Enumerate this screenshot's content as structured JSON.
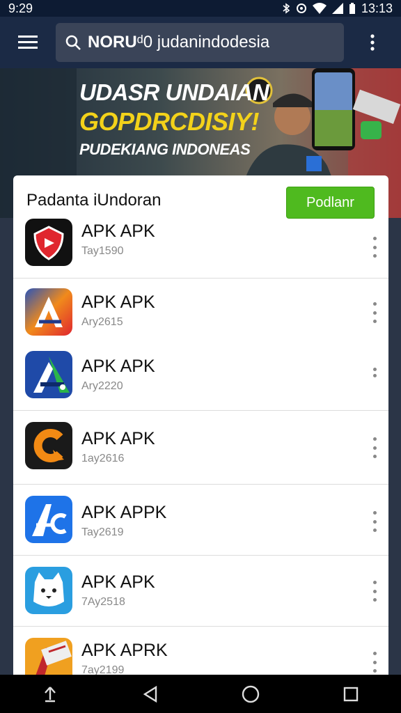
{
  "status_bar": {
    "time": "9:29",
    "right_time": "13:13"
  },
  "search": {
    "query_bold": "NORU",
    "query_rest": "ᵈ0 judanindodesia"
  },
  "banner": {
    "line1": "UDASR UNDAIAN",
    "line2": "GOPDRCDISIY!",
    "line3": "PUDEKIANG INDONEAS"
  },
  "panel": {
    "title": "Padanta iUndoran",
    "button_label": "Podlanr"
  },
  "apps": [
    {
      "name": "APK APK",
      "sub": "Tay1590",
      "icon": "shield-play-icon",
      "bg": "#111111",
      "fg": "#e0262e"
    },
    {
      "name": "APK APK",
      "sub": "Ary2615",
      "icon": "letter-a-gradient-icon",
      "bg": "#f08a1c",
      "fg": "#1f3a8a"
    },
    {
      "name": "APK APK",
      "sub": "Ary2220",
      "icon": "letter-a-blue-icon",
      "bg": "#1f4aa8",
      "fg": "#2bb44a"
    },
    {
      "name": "APK APK",
      "sub": "1ay2616",
      "icon": "letter-c-orange-icon",
      "bg": "#1a1a1a",
      "fg": "#f28a14"
    },
    {
      "name": "APK APPK",
      "sub": "Tay2619",
      "icon": "letter-ac-blue-icon",
      "bg": "#1e73e8",
      "fg": "#ffffff"
    },
    {
      "name": "APK APK",
      "sub": "7Ay2518",
      "icon": "cat-face-icon",
      "bg": "#2a9ee0",
      "fg": "#ffffff"
    },
    {
      "name": "APK APRK",
      "sub": "7ay2199",
      "icon": "letter-a-stamp-icon",
      "bg": "#f0a020",
      "fg": "#c0282c"
    }
  ]
}
